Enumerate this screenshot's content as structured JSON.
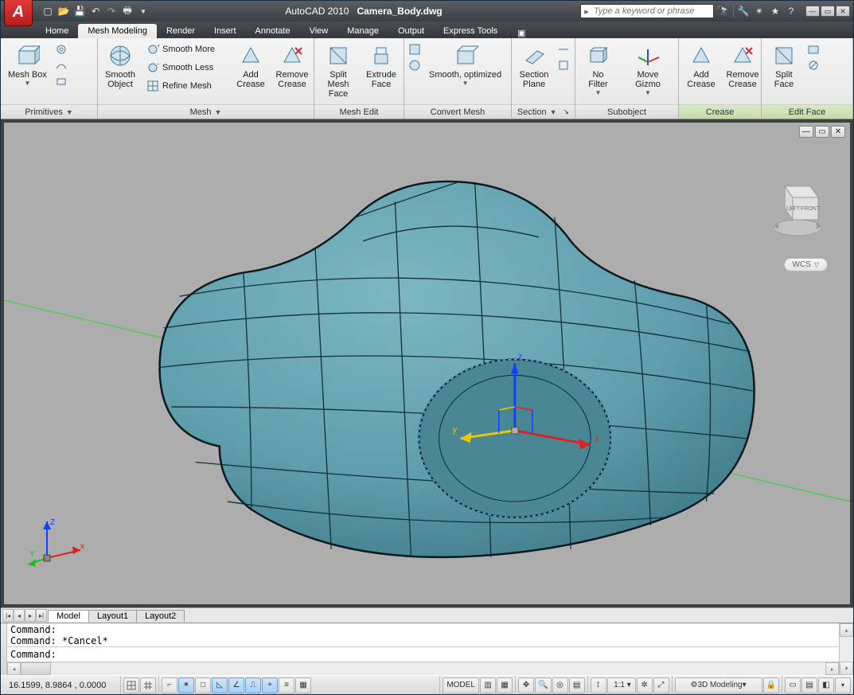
{
  "title": {
    "app": "AutoCAD 2010",
    "file": "Camera_Body.dwg"
  },
  "search": {
    "placeholder": "Type a keyword or phrase"
  },
  "menus": [
    "Home",
    "Mesh Modeling",
    "Render",
    "Insert",
    "Annotate",
    "View",
    "Manage",
    "Output",
    "Express Tools"
  ],
  "menu_active_index": 1,
  "ribbon": {
    "panels": [
      {
        "label": "Primitives",
        "expander": true
      },
      {
        "label": "Mesh",
        "expander": true
      },
      {
        "label": "Mesh Edit",
        "expander": false
      },
      {
        "label": "Convert Mesh",
        "expander": false
      },
      {
        "label": "Section",
        "expander": true
      },
      {
        "label": "Subobject",
        "expander": false
      },
      {
        "label": "Crease",
        "expander": false,
        "highlight": true
      },
      {
        "label": "Edit Face",
        "expander": false,
        "highlight": true
      }
    ],
    "btns": {
      "mesh_box": "Mesh Box",
      "smooth_object": "Smooth\nObject",
      "smooth_more": "Smooth More",
      "smooth_less": "Smooth Less",
      "refine_mesh": "Refine Mesh",
      "add_crease": "Add\nCrease",
      "remove_crease": "Remove\nCrease",
      "split_mesh_face": "Split\nMesh Face",
      "extrude_face": "Extrude\nFace",
      "smooth_optimized": "Smooth, optimized",
      "section_plane": "Section\nPlane",
      "no_filter": "No Filter",
      "move_gizmo": "Move Gizmo",
      "add_crease2": "Add\nCrease",
      "remove_crease2": "Remove\nCrease",
      "split_face": "Split\nFace"
    }
  },
  "viewcube": {
    "left": "LEFT",
    "front": "FRONT"
  },
  "wcs": "WCS",
  "gizmo": {
    "x": "x",
    "y": "y",
    "z": "z"
  },
  "ucs": {
    "x": "x",
    "y": "Y",
    "z": "Z"
  },
  "layout_tabs": [
    "Model",
    "Layout1",
    "Layout2"
  ],
  "layout_active": 0,
  "command": {
    "history": [
      "Command:",
      "Command: *Cancel*",
      "Command:"
    ],
    "prompt": "Command:"
  },
  "status": {
    "coords": "16.1599, 8.9864 , 0.0000",
    "model": "MODEL",
    "scale": "1:1",
    "workspace": "3D Modeling"
  }
}
